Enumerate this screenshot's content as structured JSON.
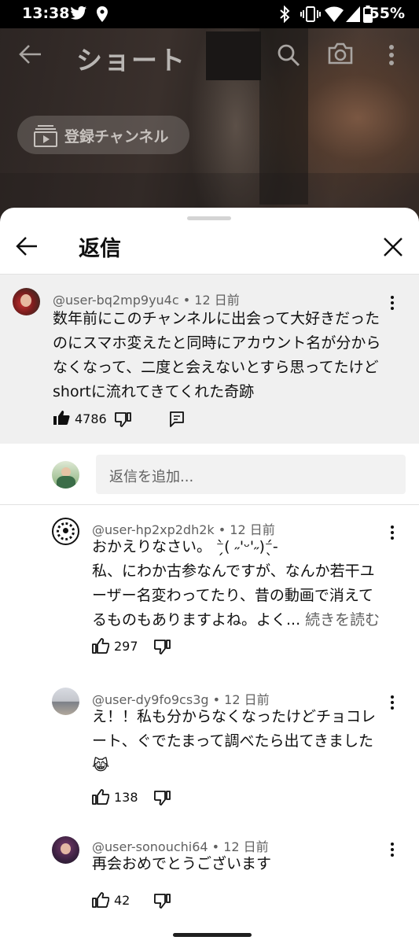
{
  "status": {
    "time": "13:38",
    "battery": "55%"
  },
  "header": {
    "title": "ショート",
    "subscriptions_label": "登録チャンネル"
  },
  "sheet": {
    "title": "返信"
  },
  "parent_comment": {
    "author": "@user-bq2mp9yu4c • 12 日前",
    "lines": [
      "数年前にこのチャンネルに出会って大好きだった",
      "のにスマホ変えたと同時にアカウント名が分から",
      "なくなって、二度と会えないとすら思ってたけど",
      "shortに流れてきてくれた奇跡"
    ],
    "likes": "4786"
  },
  "add_reply": {
    "placeholder": "返信を追加..."
  },
  "replies": [
    {
      "author": "@user-hp2xp2dh2k • 12 日前",
      "lines": [
        "おかえりなさい。 ⁻̗̀( ˶'ᵕ'˶)⁻̖́-",
        "私、にわか古参なんですが、なんか若干ユ",
        "ーザー名変わってたり、昔の動画で消えて",
        "るものもありますよね。よく..."
      ],
      "more_label": " 続きを読む",
      "likes": "297"
    },
    {
      "author": "@user-dy9fo9cs3g • 12 日前",
      "lines": [
        "え！！私も分からなくなったけどチョコレ",
        "ート、ぐでたまって調べたら出てきました",
        "😹"
      ],
      "likes": "138"
    },
    {
      "author": "@user-sonouchi64 • 12 日前",
      "lines": [
        "再会おめでとうございます"
      ],
      "likes": "42"
    }
  ],
  "colors": {
    "sheet_bg": "#ffffff",
    "parent_bg": "#f0f0f0",
    "secondary_text": "#606060",
    "primary_text": "#0f0f0f"
  }
}
